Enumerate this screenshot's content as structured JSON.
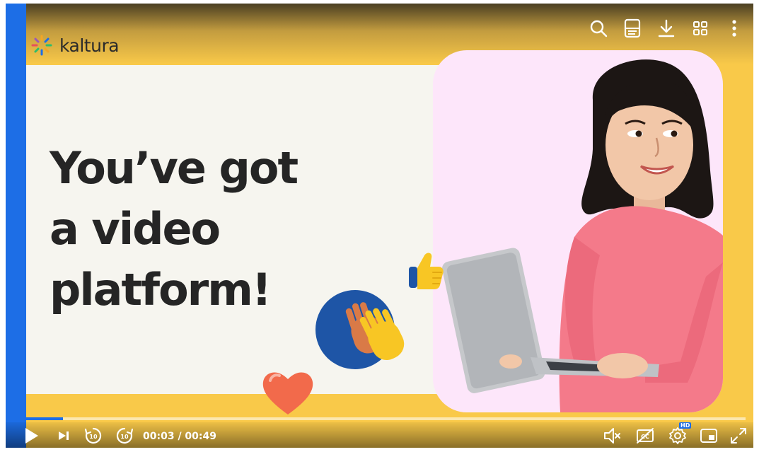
{
  "brand": {
    "name": "kaltura"
  },
  "headline": {
    "line1": "You’ve got",
    "line2": "a video",
    "line3": "platform!"
  },
  "top_controls": [
    "search-icon",
    "transcript-icon",
    "download-icon",
    "grid-icon",
    "more-icon"
  ],
  "controls": {
    "current_time": "00:03",
    "duration": "00:49",
    "separator": " / ",
    "time_display": "00:03 / 00:49",
    "progress": 0.061,
    "hd_label": "HD",
    "muted": true,
    "captions_off": true
  },
  "colors": {
    "accent": "#1d6ee6",
    "stage_yellow": "#f9c949",
    "panel": "#f6f5ef",
    "photo_bg": "#fde6fa",
    "headline": "#252525"
  }
}
